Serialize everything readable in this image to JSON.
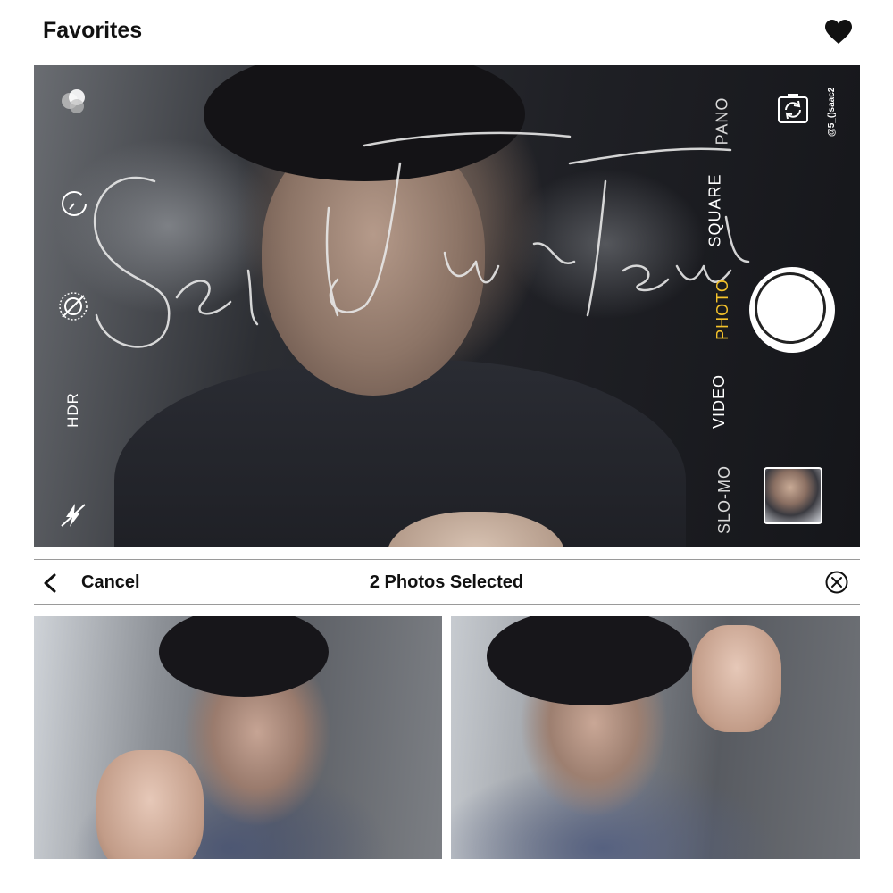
{
  "header": {
    "title": "Favorites",
    "icon": "heart-icon"
  },
  "camera": {
    "left_controls": {
      "live_icon": "live-photo-icon",
      "timer_icon": "timer-icon",
      "live_off_icon": "live-off-icon",
      "hdr_label": "HDR",
      "flash_icon": "flash-off-icon"
    },
    "modes": [
      "PANO",
      "SQUARE",
      "PHOTO",
      "VIDEO",
      "SLO-MO"
    ],
    "active_mode": "PHOTO",
    "flip_icon": "camera-flip-icon",
    "handle": "@5_()saac2",
    "accent_color": "#f4c22b"
  },
  "selection_bar": {
    "cancel_label": "Cancel",
    "selected_label": "2 Photos Selected",
    "back_icon": "chevron-left-icon",
    "close_icon": "close-circle-icon"
  },
  "photos": [
    {
      "name": "selected-photo-1"
    },
    {
      "name": "selected-photo-2"
    }
  ]
}
